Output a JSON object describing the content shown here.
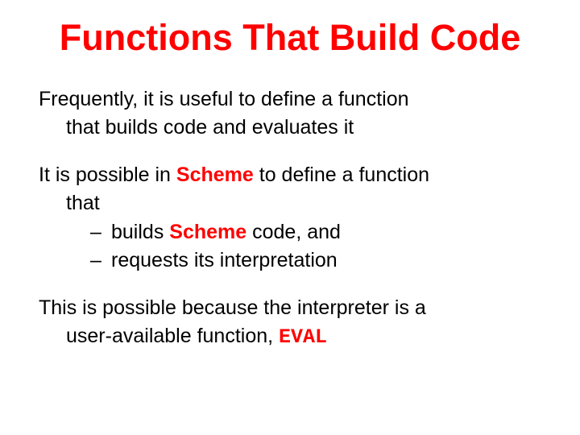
{
  "title": "Functions That Build Code",
  "p1_a": "Frequently, it is useful to define a function",
  "p1_b": "that builds code and evaluates it",
  "p2_a_pre": "It is possible in ",
  "scheme": "Scheme",
  "p2_a_post": " to define a function",
  "p2_b": "that",
  "b1_pre": "builds ",
  "b1_post": " code, and",
  "b2": "requests its interpretation",
  "p3_a": "This is possible because the interpreter is a",
  "p3_b_pre": "user-available function, ",
  "eval": "EVAL"
}
